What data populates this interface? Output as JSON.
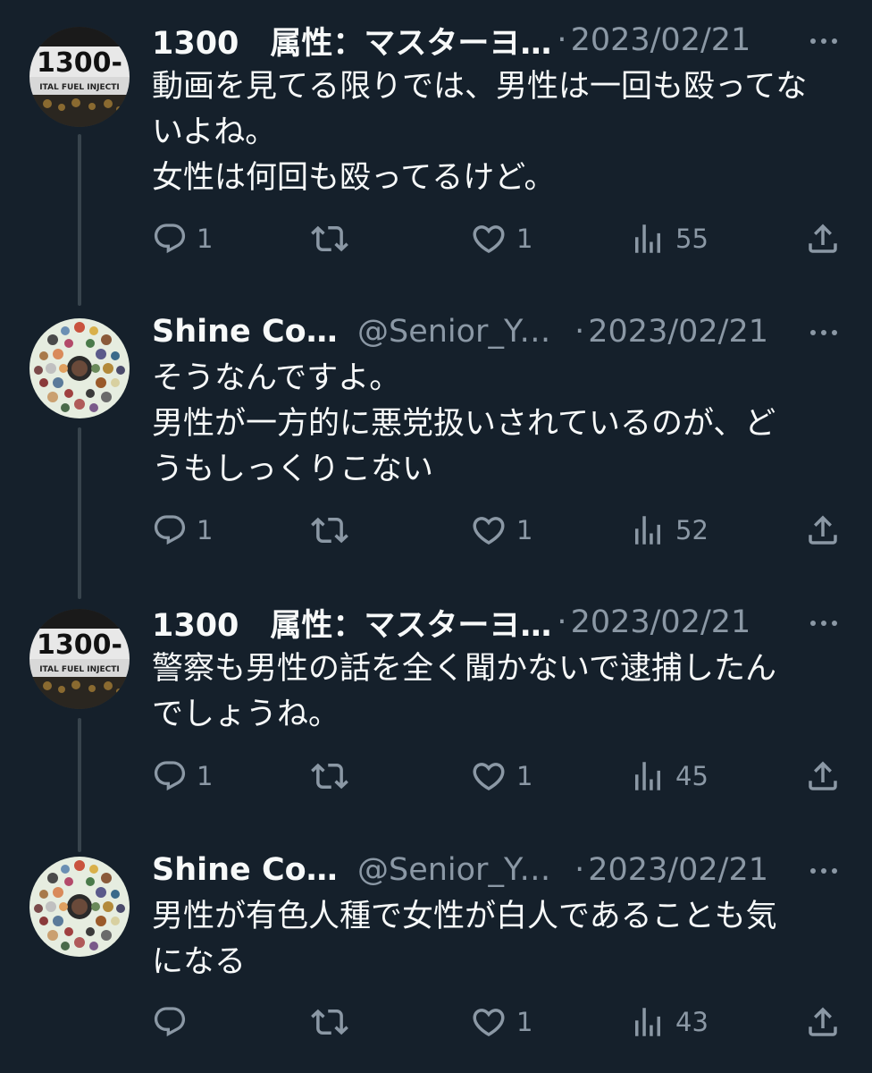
{
  "tweets": [
    {
      "name": "1300　属性：マスターヨ…",
      "handle": "",
      "dot": "·",
      "date": "2023/02/21",
      "lines": [
        "動画を見てる限りでは、男性は一回も殴ってな",
        "いよね。",
        "女性は何回も殴ってるけど。"
      ],
      "replies": "1",
      "retweets": "",
      "likes": "1",
      "views": "55",
      "avatar": "1300-engine-badge"
    },
    {
      "name": "Shine Cove",
      "handle": "@Senior_Yu…",
      "dot": "·",
      "date": "2023/02/21",
      "lines": [
        "そうなんですよ。",
        "男性が一方的に悪党扱いされているのが、ど",
        "うもしっくりこない"
      ],
      "replies": "1",
      "retweets": "",
      "likes": "1",
      "views": "52",
      "avatar": "circle-collage"
    },
    {
      "name": "1300　属性：マスターヨ…",
      "handle": "",
      "dot": "·",
      "date": "2023/02/21",
      "lines": [
        "警察も男性の話を全く聞かないで逮捕したん",
        "でしょうね。"
      ],
      "replies": "1",
      "retweets": "",
      "likes": "1",
      "views": "45",
      "avatar": "1300-engine-badge"
    },
    {
      "name": "Shine Cove",
      "handle": "@Senior_Yu…",
      "dot": "·",
      "date": "2023/02/21",
      "lines": [
        "男性が有色人種で女性が白人であることも気",
        "になる"
      ],
      "replies": "",
      "retweets": "",
      "likes": "1",
      "views": "43",
      "avatar": "circle-collage"
    }
  ],
  "avatar_text": {
    "line1": "1300-",
    "line2": "ITAL FUEL INJECTI"
  },
  "icons": {
    "reply": "reply-icon",
    "retweet": "retweet-icon",
    "like": "heart-icon",
    "views": "views-bar-icon",
    "share": "share-icon",
    "more": "more-dots-icon"
  },
  "colors": {
    "background": "#15202b",
    "text": "#f7f9f9",
    "secondary": "#8b98a5",
    "thread_line": "#38444d"
  }
}
